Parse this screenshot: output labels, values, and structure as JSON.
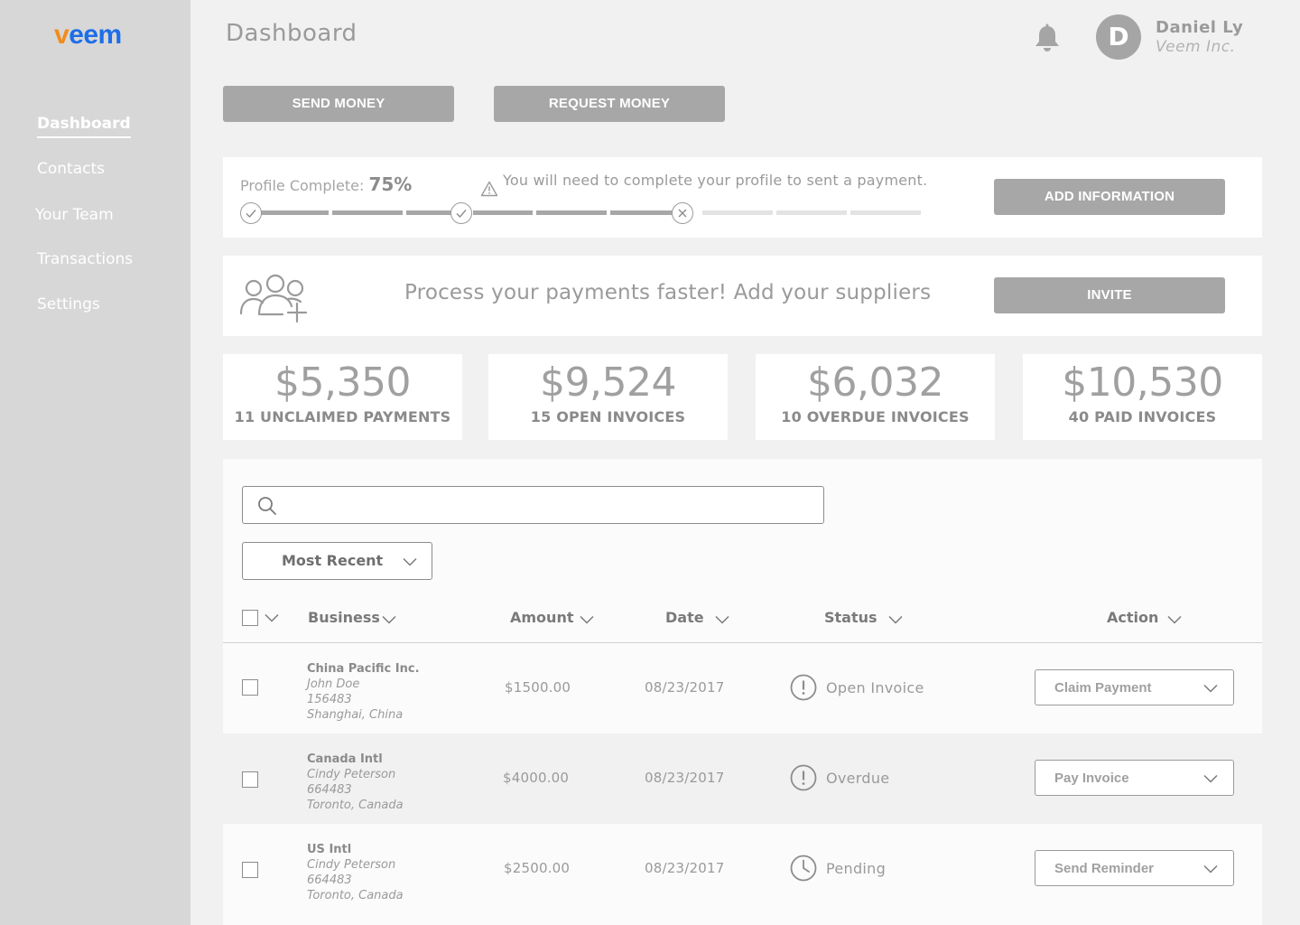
{
  "brand": {
    "logo_v": "v",
    "logo_rest": "eem"
  },
  "sidebar": {
    "items": [
      {
        "label": "Dashboard",
        "active": true
      },
      {
        "label": "Contacts"
      },
      {
        "label": "Your Team"
      },
      {
        "label": "Transactions"
      },
      {
        "label": "Settings"
      }
    ]
  },
  "header": {
    "title": "Dashboard",
    "user": {
      "initial": "D",
      "name": "Daniel Ly",
      "company": "Veem Inc."
    }
  },
  "actions": {
    "send": "SEND MONEY",
    "request": "REQUEST MONEY"
  },
  "profile": {
    "label": "Profile Complete:",
    "percent": "75%",
    "percent_value": 75,
    "warning": "You will need to complete your profile to sent a payment.",
    "button": "ADD INFORMATION"
  },
  "invite": {
    "text": "Process your payments faster! Add your suppliers",
    "button": "INVITE"
  },
  "stats": [
    {
      "amount": "$5,350",
      "label": "11 UNCLAIMED PAYMENTS"
    },
    {
      "amount": "$9,524",
      "label": "15 OPEN INVOICES"
    },
    {
      "amount": "$6,032",
      "label": "10 OVERDUE INVOICES"
    },
    {
      "amount": "$10,530",
      "label": "40 PAID INVOICES"
    }
  ],
  "search": {
    "placeholder": "",
    "value": ""
  },
  "sort": {
    "selected": "Most Recent"
  },
  "table": {
    "columns": [
      "Business",
      "Amount",
      "Date",
      "Status",
      "Action"
    ],
    "rows": [
      {
        "business": "China Pacific Inc.",
        "contact": "John Doe",
        "id": "156483",
        "location": "Shanghai, China",
        "amount": "$1500.00",
        "date": "08/23/2017",
        "status": "Open Invoice",
        "status_icon": "exclamation-circle-icon",
        "action": "Claim Payment"
      },
      {
        "business": "Canada Intl",
        "contact": "Cindy Peterson",
        "id": "664483",
        "location": "Toronto, Canada",
        "amount": "$4000.00",
        "date": "08/23/2017",
        "status": "Overdue",
        "status_icon": "exclamation-circle-icon",
        "action": "Pay Invoice"
      },
      {
        "business": "US Intl",
        "contact": "Cindy Peterson",
        "id": "664483",
        "location": "Toronto, Canada",
        "amount": "$2500.00",
        "date": "08/23/2017",
        "status": "Pending",
        "status_icon": "clock-icon",
        "action": "Send Reminder"
      }
    ]
  },
  "colors": {
    "sidebar": "#d7d7d7",
    "background": "#f2f1f1",
    "button": "#a7a7a7",
    "logo_orange": "#f28c1a",
    "logo_blue": "#1e6ee8"
  }
}
